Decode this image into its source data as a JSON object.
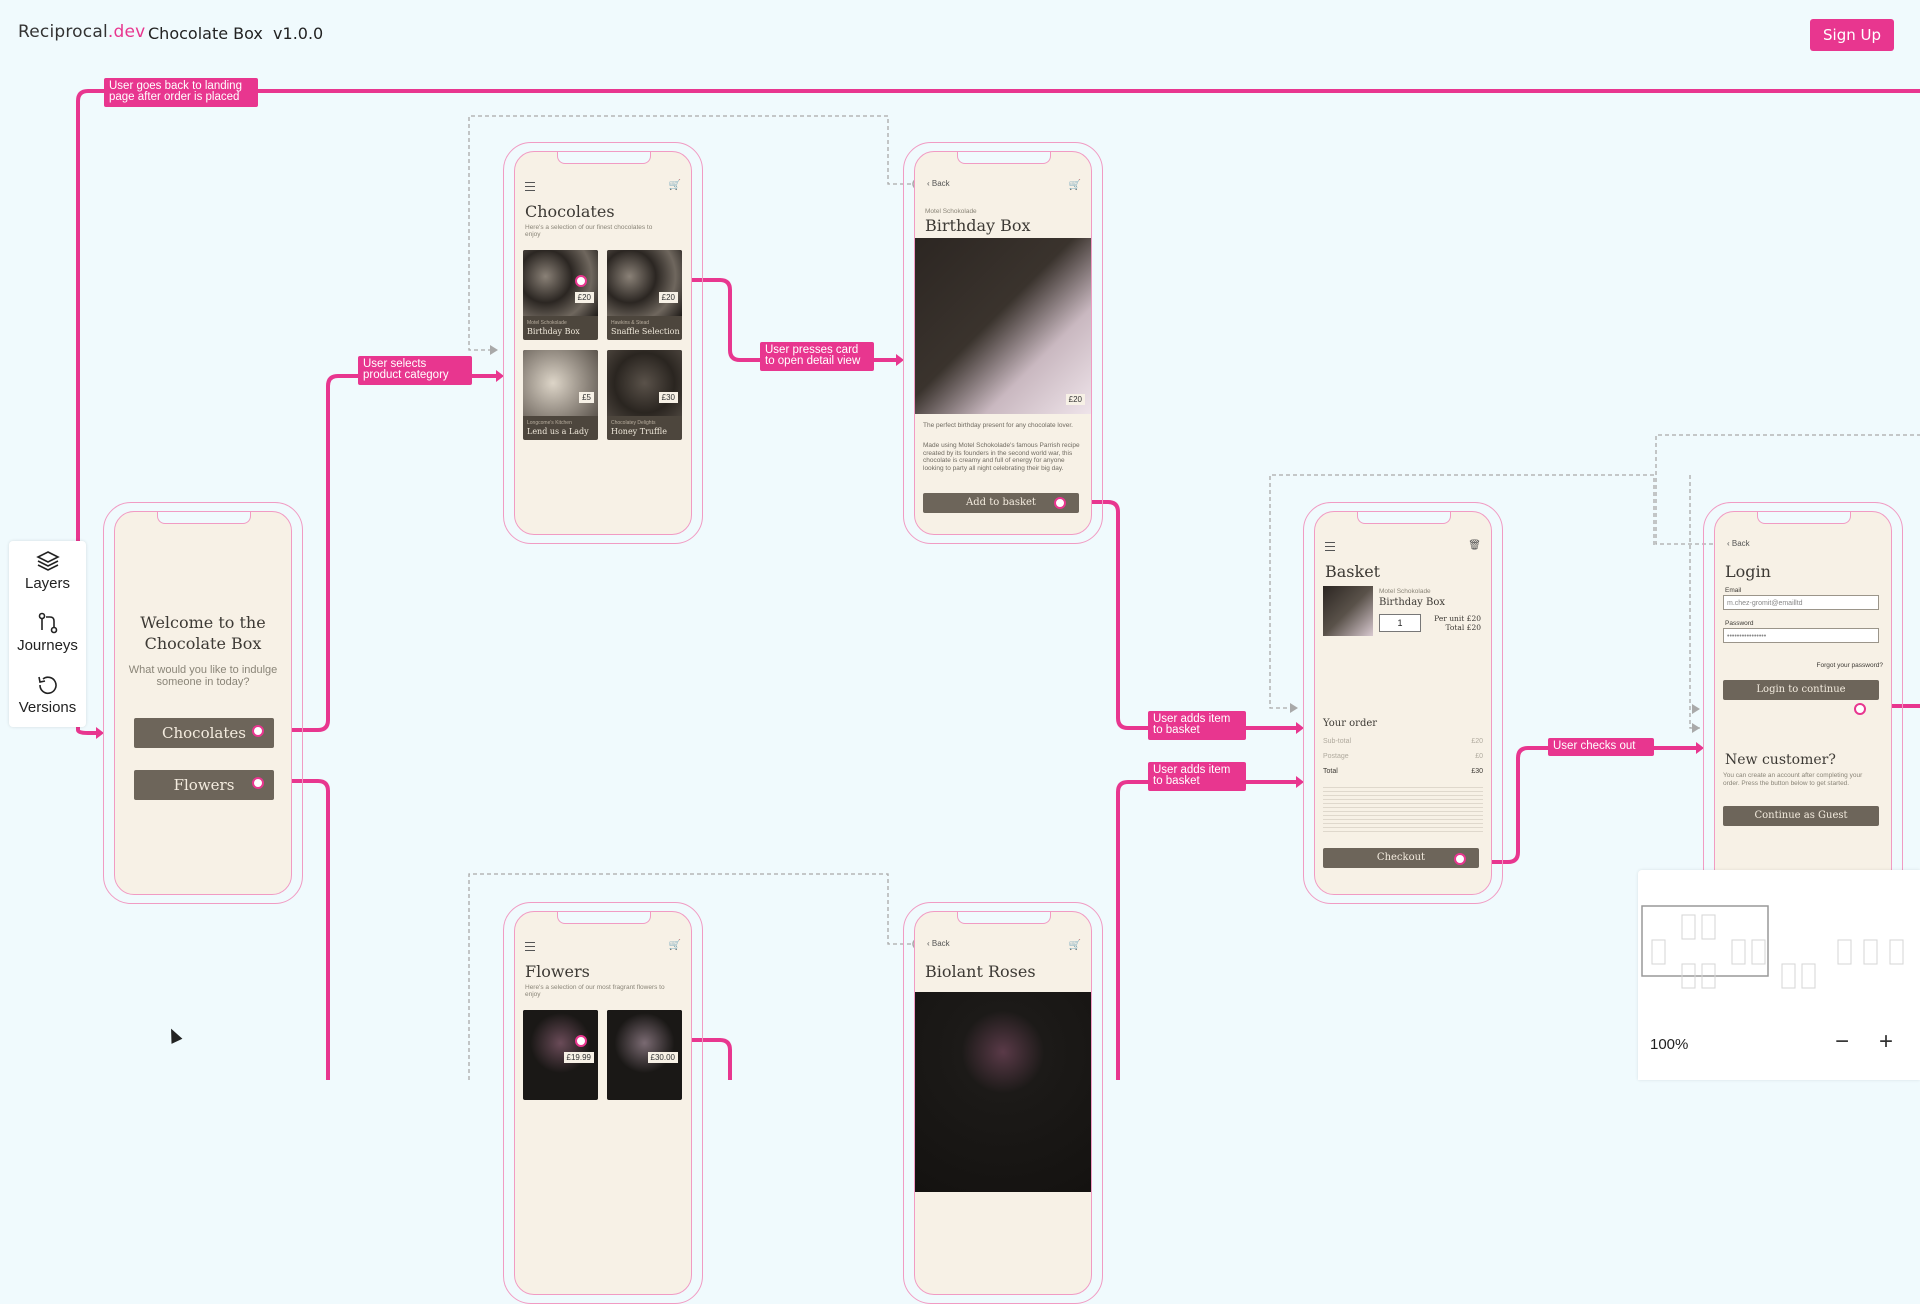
{
  "header": {
    "logo_main": "Reciprocal",
    "logo_suffix": ".dev",
    "app_title": "Chocolate Box  v1.0.0",
    "signup_label": "Sign Up"
  },
  "sidebar": {
    "items": [
      {
        "label": "Layers",
        "icon": "layers-icon"
      },
      {
        "label": "Journeys",
        "icon": "journeys-icon"
      },
      {
        "label": "Versions",
        "icon": "versions-icon"
      }
    ]
  },
  "flow_labels": {
    "back_to_landing": "User goes back to landing page after order is placed",
    "select_category": "User selects product category",
    "open_detail": "User presses card to open detail view",
    "add_item_1": "User adds item to basket",
    "add_item_2": "User adds item to basket",
    "checks_out": "User checks out"
  },
  "screens": {
    "welcome": {
      "title": "Welcome to the Chocolate Box",
      "subtitle": "What would you like to indulge someone in today?",
      "btn_chocolates": "Chocolates",
      "btn_flowers": "Flowers"
    },
    "chocolates": {
      "title": "Chocolates",
      "subtitle": "Here's a selection of our finest chocolates to enjoy",
      "tiles": [
        {
          "name": "Birthday Box",
          "price": "£20",
          "brand": "Motel Schokolade"
        },
        {
          "name": "Snaffle Selection",
          "price": "£20",
          "brand": "Hawkins & Stead"
        },
        {
          "name": "Lend us a Lady",
          "price": "£5",
          "brand": "Longcome's Kitchen"
        },
        {
          "name": "Honey Truffle",
          "price": "£30",
          "brand": "Chocolatey Delights"
        }
      ]
    },
    "detail": {
      "back": "Back",
      "brand": "Motel Schokolade",
      "title": "Birthday Box",
      "price": "£20",
      "desc1": "The perfect birthday present for any chocolate lover.",
      "desc2": "Made using Motel Schokolade's famous Parrish recipe created by its founders in the second world war, this chocolate is creamy and full of energy for anyone looking to party all night celebrating their big day.",
      "add_btn": "Add to basket"
    },
    "basket": {
      "title": "Basket",
      "brand": "Motel Schokolade",
      "item": "Birthday Box",
      "qty": "1",
      "per_unit": "Per unit £20",
      "total_line": "Total £20",
      "your_order": "Your order",
      "subtotal_label": "Sub-total",
      "subtotal_value": "£20",
      "postage_label": "Postage",
      "postage_value": "£0",
      "total_label": "Total",
      "total_value": "£30",
      "checkout_btn": "Checkout"
    },
    "login": {
      "back": "Back",
      "title": "Login",
      "email_label": "Email",
      "email_value": "m.chez-gromit@emailltd",
      "password_label": "Password",
      "password_value": "••••••••••••••••",
      "forgot": "Forgot your password?",
      "login_btn": "Login to continue",
      "new_customer": "New customer?",
      "new_customer_text": "You can create an account after completing your order. Press the button below to get started.",
      "guest_btn": "Continue as Guest"
    },
    "flowers": {
      "title": "Flowers",
      "subtitle": "Here's a selection of our most fragrant flowers to enjoy",
      "tiles": [
        {
          "price": "£19.99"
        },
        {
          "price": "£30.00"
        }
      ]
    },
    "roses": {
      "back": "Back",
      "title": "Biolant Roses"
    }
  },
  "minimap": {
    "zoom": "100%",
    "zoom_out": "−",
    "zoom_in": "+"
  },
  "colors": {
    "accent": "#e8368f",
    "background": "#f0fafd",
    "screen": "#f7f1e6",
    "button": "#6d655a"
  }
}
